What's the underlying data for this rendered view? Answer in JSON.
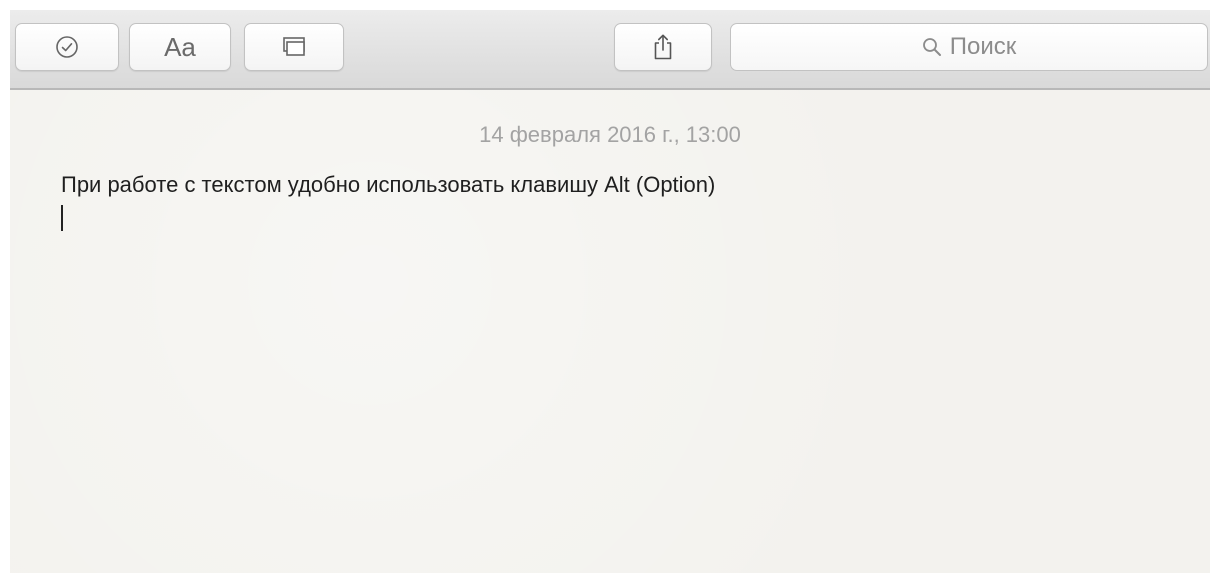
{
  "toolbar": {
    "buttons": [
      {
        "name": "checklist-button",
        "icon": "checklist-circle-icon"
      },
      {
        "name": "format-button",
        "label": "Aa"
      },
      {
        "name": "attachment-button",
        "icon": "gallery-icon"
      },
      {
        "name": "share-button",
        "icon": "share-icon"
      }
    ],
    "search": {
      "icon": "search-icon",
      "placeholder": "Поиск"
    }
  },
  "note": {
    "date": "14 февраля 2016 г., 13:00",
    "text": "При работе с текстом удобно использовать клавишу Alt (Option)"
  },
  "colors": {
    "toolbar_bg": "#dedede",
    "note_bg": "#f3f2ee",
    "date_text": "#a3a3a3",
    "body_text": "#1f1f1f"
  }
}
